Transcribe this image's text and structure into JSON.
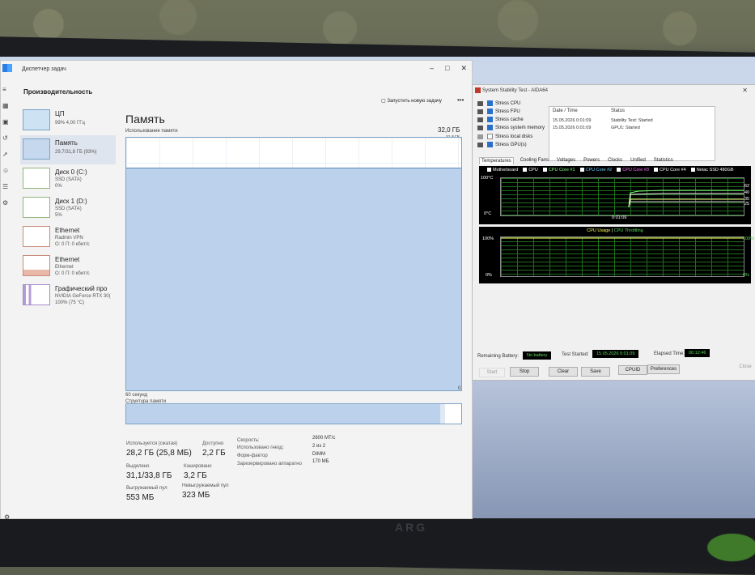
{
  "task_manager": {
    "title": "Диспетчер задач",
    "section": "Производительность",
    "run_task_label": "Запустить новую задачу",
    "more_label": "•••",
    "heading": "Память",
    "graph_label": "Использование памяти",
    "total": "32,0 ГБ",
    "graph_max": "31,8 ГБ",
    "time_left": "60 секунд",
    "time_right": "0",
    "struct_label": "Структура памяти",
    "usage_fraction": 0.88,
    "devices": [
      {
        "name": "ЦП",
        "sub1": "99% 4,00 ГГц",
        "sub2": ""
      },
      {
        "name": "Память",
        "sub1": "29,7/31,8 ГБ (93%)",
        "sub2": ""
      },
      {
        "name": "Диск 0 (C:)",
        "sub1": "SSD (SATA)",
        "sub2": "0%"
      },
      {
        "name": "Диск 1 (D:)",
        "sub1": "SSD (SATA)",
        "sub2": "5%"
      },
      {
        "name": "Ethernet",
        "sub1": "Radmin VPN",
        "sub2": "О: 0 П: 0 кбит/с"
      },
      {
        "name": "Ethernet",
        "sub1": "Ethernet",
        "sub2": "О: 0 П: 0 кбит/с"
      },
      {
        "name": "Графический про",
        "sub1": "NVIDIA GeForce RTX 30(",
        "sub2": "100% (75 °C)"
      }
    ],
    "stats": {
      "in_use_label": "Используется (сжатая)",
      "in_use": "28,2 ГБ (25,8 МБ)",
      "available_label": "Доступно",
      "available": "2,2 ГБ",
      "committed_label": "Выделено",
      "committed": "31,1/33,8 ГБ",
      "cached_label": "Кэшировано",
      "cached": "3,2 ГБ",
      "paged_label": "Выгружаемый пул",
      "paged": "553 МБ",
      "nonpaged_label": "Невыгружаемый пул",
      "nonpaged": "323 МБ",
      "speed_label": "Скорость:",
      "speed": "2600 МТ/с",
      "slots_label": "Использовано гнезд:",
      "slots": "2 из 2",
      "form_label": "Форм-фактор",
      "form": "DIMM",
      "reserved_label": "Зарезервировано аппаратно",
      "reserved": "170 МБ"
    }
  },
  "aida": {
    "title": "System Stability Test - AIDA64",
    "stress": [
      {
        "label": "Stress CPU",
        "checked": true
      },
      {
        "label": "Stress FPU",
        "checked": true
      },
      {
        "label": "Stress cache",
        "checked": true
      },
      {
        "label": "Stress system memory",
        "checked": true
      },
      {
        "label": "Stress local disks",
        "checked": false
      },
      {
        "label": "Stress GPU(s)",
        "checked": true
      }
    ],
    "log_headers": {
      "date": "Date / Time",
      "status": "Status"
    },
    "log_rows": [
      {
        "date": "15.05.2026 0:01:09",
        "status": "Stability Test: Started"
      },
      {
        "date": "15.05.2026 0:01:09",
        "status": "GPU1: Started"
      }
    ],
    "tabs": [
      "Temperatures",
      "Cooling Fans",
      "Voltages",
      "Powers",
      "Clocks",
      "Unified",
      "Statistics"
    ],
    "temp_legend": [
      {
        "label": "Motherboard",
        "color": "#ffffff"
      },
      {
        "label": "CPU",
        "color": "#ffffff"
      },
      {
        "label": "CPU Core #1",
        "color": "#7dff7d"
      },
      {
        "label": "CPU Core #2",
        "color": "#6fd0ff"
      },
      {
        "label": "CPU Core #3",
        "color": "#ff6bff"
      },
      {
        "label": "CPU Core #4",
        "color": "#ffffff"
      },
      {
        "label": "Netac SSD 480GB",
        "color": "#ffffff"
      }
    ],
    "temp_axis_top": "100°C",
    "temp_axis_bottom": "0°C",
    "temp_time": "0:01:09",
    "temp_right": [
      "62",
      "40",
      "35",
      "25"
    ],
    "usage_title_a": "CPU Usage",
    "usage_sep": "|",
    "usage_title_b": "CPU Throttling",
    "usage_top": "100%",
    "usage_bottom": "0%",
    "usage_right_top": "100%",
    "usage_right_bottom": "0%",
    "battery_label": "Remaining Battery:",
    "battery": "No battery",
    "started_label": "Test Started:",
    "started": "15.05.2026 0:01:09",
    "elapsed_label": "Elapsed Time:",
    "elapsed": "00:12:46",
    "buttons": {
      "start": "Start",
      "stop": "Stop",
      "clear": "Clear",
      "save": "Save",
      "cpuid": "CPUID",
      "prefs": "Preferences",
      "close": "Close"
    }
  },
  "monitor_brand": "ARG"
}
